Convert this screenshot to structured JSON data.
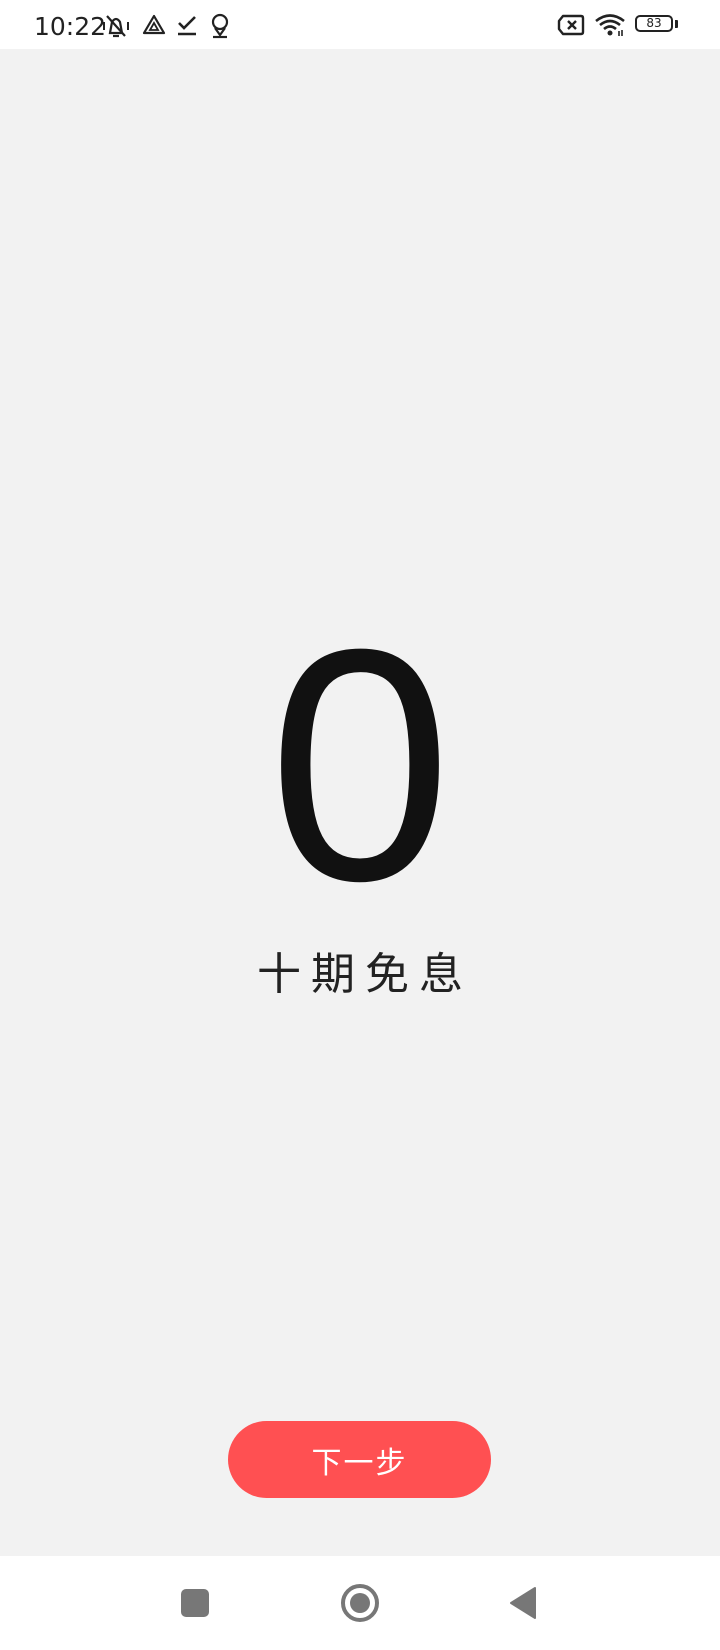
{
  "status_bar": {
    "time": "10:22",
    "left_icons": [
      "mute-vibrate-icon",
      "drive-icon",
      "checkmark-icon",
      "location-pin-icon"
    ],
    "right_icons": [
      "sim-blocked-icon",
      "wifi-icon",
      "battery-icon"
    ],
    "battery_level": "83"
  },
  "main": {
    "big_number": "0",
    "subtitle": "十期免息"
  },
  "actions": {
    "next_label": "下一步"
  },
  "nav_bar": {
    "buttons": [
      "recents-button",
      "home-button",
      "back-button"
    ]
  },
  "colors": {
    "background": "#f2f2f2",
    "accent": "#ff5052"
  }
}
